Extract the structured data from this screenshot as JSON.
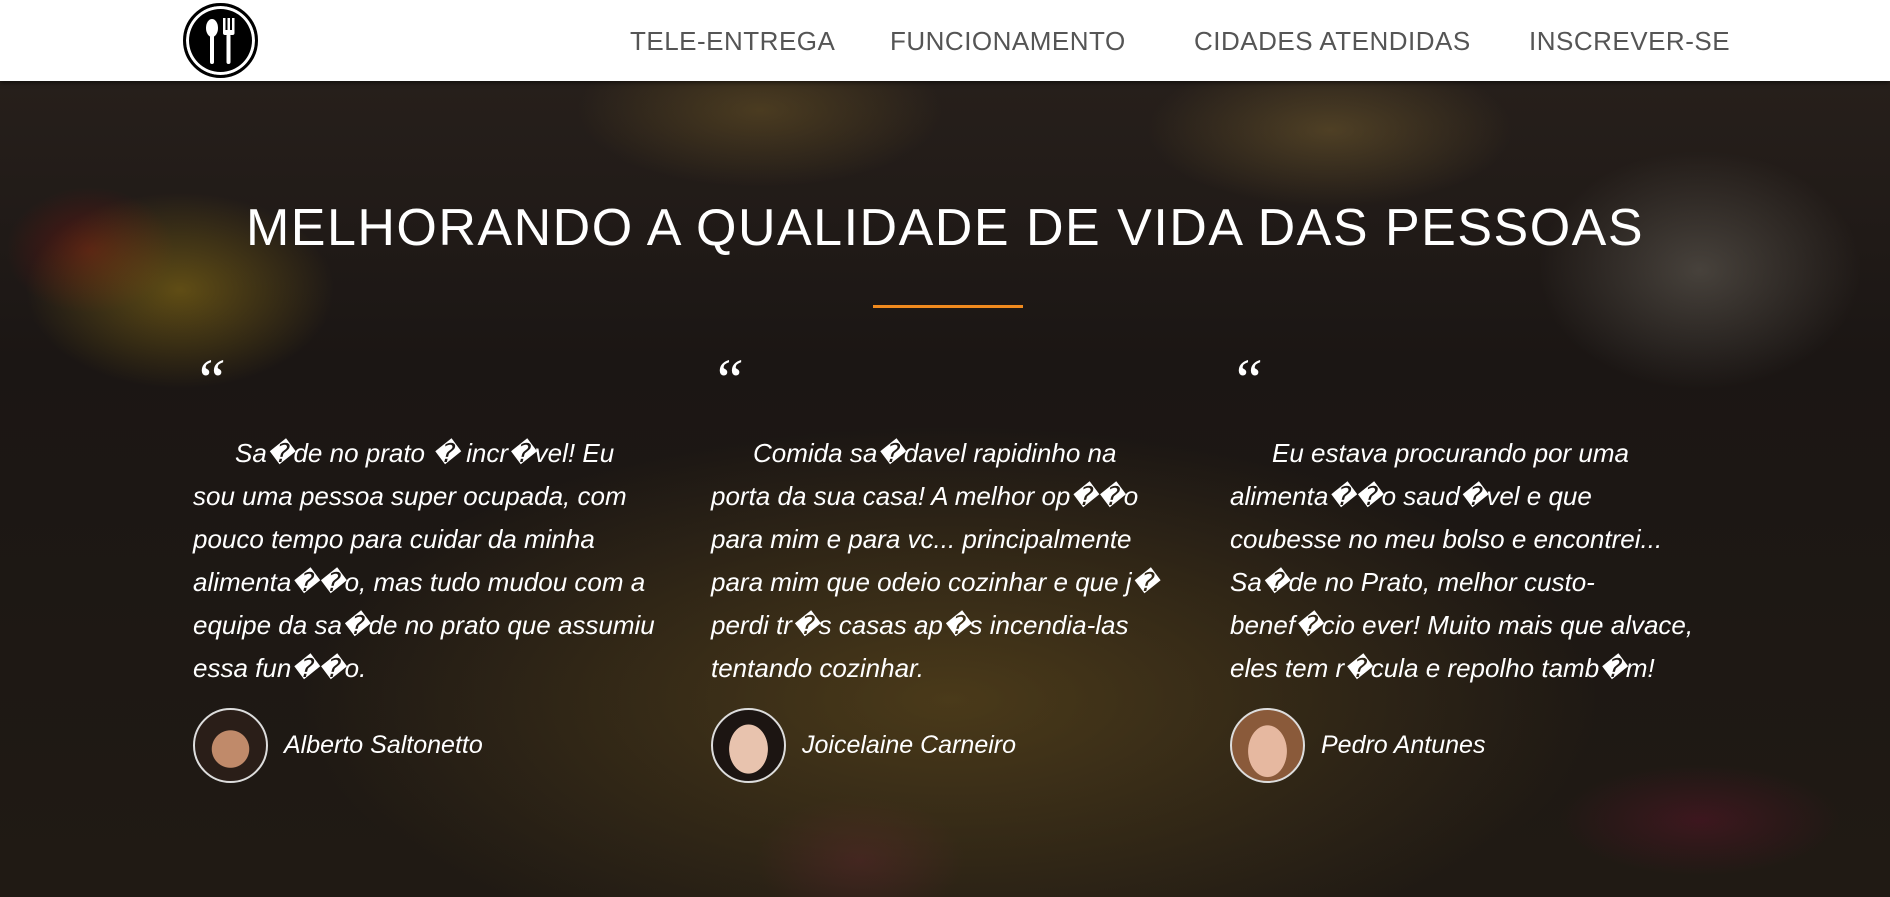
{
  "nav": {
    "logo_icon": "spoon-fork-icon",
    "items": [
      "TELE-ENTREGA",
      "FUNCIONAMENTO",
      "CIDADES ATENDIDAS",
      "INSCREVER-SE"
    ]
  },
  "hero": {
    "title": "MELHORANDO A QUALIDADE DE VIDA DAS PESSOAS",
    "accent": "#f08a1e"
  },
  "testimonials": [
    {
      "quote_mark": "“",
      "text": "Sa�de no prato � incr�vel! Eu sou uma pessoa super ocupada, com pouco tempo para cuidar da minha alimenta��o, mas tudo mudou com a equipe da sa�de no prato que assumiu essa fun��o.",
      "name": "Alberto Saltonetto"
    },
    {
      "quote_mark": "“",
      "text": "Comida sa�davel rapidinho na porta da sua casa! A melhor op��o para mim e para vc... principalmente para mim que odeio cozinhar e que j� perdi tr�s casas ap�s incendia-las tentando cozinhar.",
      "name": "Joicelaine Carneiro"
    },
    {
      "quote_mark": "“",
      "text": "Eu estava procurando por uma alimenta��o saud�vel e que coubesse no meu bolso e encontrei... Sa�de no Prato, melhor custo-benef�cio ever! Muito mais que alvace, eles tem r�cula e repolho tamb�m!",
      "name": "Pedro Antunes"
    }
  ]
}
